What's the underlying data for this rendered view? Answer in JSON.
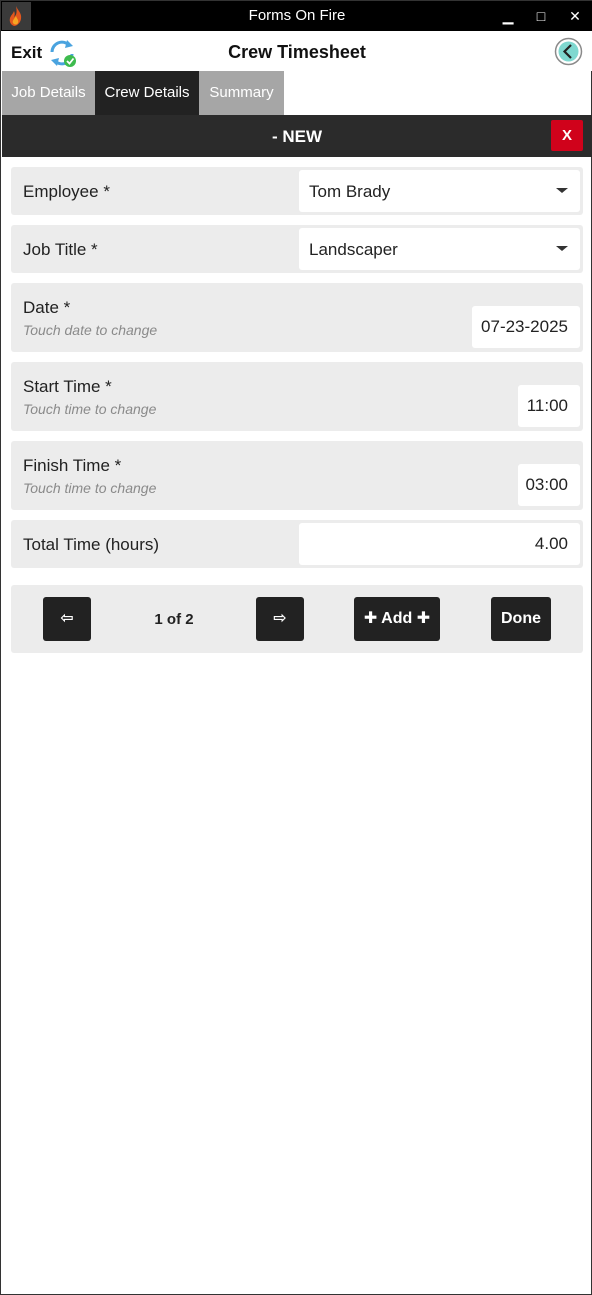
{
  "window": {
    "title": "Forms On Fire",
    "minimize": "▁",
    "maximize": "□",
    "close": "✕"
  },
  "header": {
    "exit_label": "Exit",
    "title": "Crew Timesheet"
  },
  "tabs": [
    {
      "label": "Job Details"
    },
    {
      "label": "Crew Details"
    },
    {
      "label": "Summary"
    }
  ],
  "section": {
    "title": "- NEW",
    "delete_label": "X"
  },
  "fields": {
    "employee": {
      "label": "Employee *",
      "value": "Tom Brady"
    },
    "job_title": {
      "label": "Job Title *",
      "value": "Landscaper"
    },
    "date": {
      "label": "Date *",
      "hint": "Touch date to change",
      "value": "07-23-2025"
    },
    "start_time": {
      "label": "Start Time *",
      "hint": "Touch time to change",
      "value": "11:00"
    },
    "finish_time": {
      "label": "Finish Time *",
      "hint": "Touch time to change",
      "value": "03:00"
    },
    "total_time": {
      "label": "Total Time (hours)",
      "value": "4.00"
    }
  },
  "pager": {
    "prev_label": "⇦",
    "next_label": "⇨",
    "indicator": "1 of 2",
    "add_label": "✚ Add ✚",
    "done_label": "Done"
  },
  "colors": {
    "accent_active_tab": "#222222",
    "inactive_tab": "#a6a6a6",
    "delete": "#d0021b",
    "field_bg": "#ececec"
  }
}
